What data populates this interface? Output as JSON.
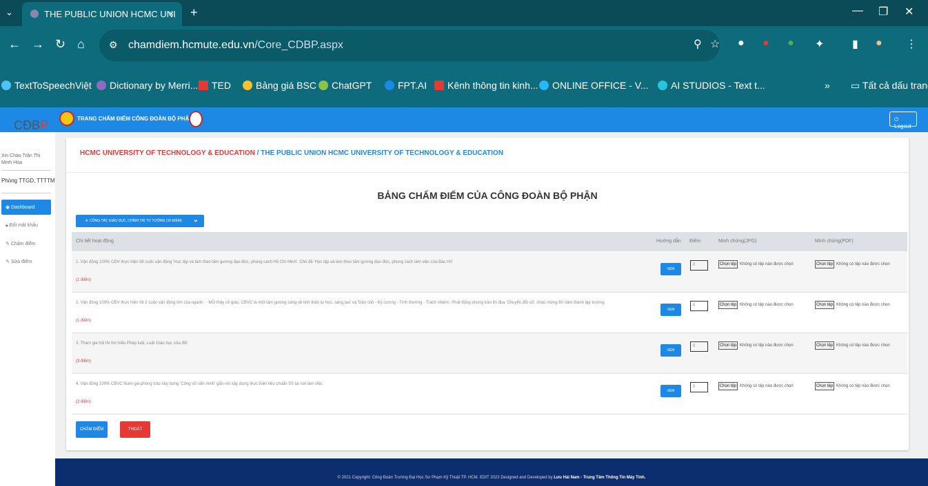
{
  "browser": {
    "tab_title": "THE PUBLIC UNION HCMC UNI",
    "tab_close": "×",
    "new_tab": "+",
    "menu_icon": "⌄",
    "url_host": "chamdiem.hcmute.edu.vn",
    "url_path": "/Core_CDBP.aspx",
    "bookmarks": [
      "TextToSpeechViệt",
      "Dictionary by Merri...",
      "TED",
      "Bảng giá BSC",
      "ChatGPT",
      "FPT.AI",
      "Kênh thông tin kinh...",
      "ONLINE OFFICE - V...",
      "AI STUDIOS - Text t..."
    ],
    "bookmarks_more": "»",
    "all_bookmarks": "Tất cả dấu trang"
  },
  "app": {
    "header_title": "TRANG CHẤM ĐIỂM CÔNG ĐOÀN BỘ PHẬN",
    "logout": "Logout",
    "brand_prefix": "CĐB",
    "brand_suffix": "P"
  },
  "sidebar": {
    "greeting": "Xin Chào Trần Thị Minh Hòa",
    "department": "Phòng TTGD, TTTTMT",
    "items": [
      "Dashboard",
      "Đổi mật khẩu",
      "Chấm điểm",
      "Sửa điểm"
    ]
  },
  "main": {
    "breadcrumb_1": "HCMC UNIVERSITY OF TECHNOLOGY & EDUCATION",
    "breadcrumb_sep": " / ",
    "breadcrumb_2": "THE PUBLIC UNION HCMC UNIVERSITY OF TECHNOLOGY & EDUCATION",
    "heading": "BẢNG CHẤM ĐIỂM CỦA CÔNG ĐOÀN BỘ PHẬN",
    "section_select": "A. CÔNG TÁC GIÁO DỤC, CHÍNH TRỊ TƯ TƯỞNG (10 ĐIỂM)",
    "columns": [
      "Chi tiết hoạt động",
      "Hướng dẫn",
      "Điểm",
      "Minh chứng(JPG)",
      "Minh chứng(PDF)"
    ],
    "view_label": "XEM",
    "choose_file": "Chọn tệp",
    "no_file": "Không có tệp nào được chọn",
    "rows": [
      {
        "text": "1. Vận động 100% CĐV thực hiện tốt cuộc vận động 'Học tập và làm theo tấm gương đạo đức, phong cách Hồ Chí Minh'. Chủ đề 'Học tập và làm theo tấm gương đạo đức, phong cách làm việc của Bác Hồ'",
        "points": "(1 điểm)",
        "score": "0"
      },
      {
        "text": "2. Vận động 100% CĐV thực hiện tốt 2 cuộc vận động lớn của ngành: - 'Mỗi thầy cô giáo, CBVC là một tấm gương sáng về tinh thần tự học, sáng tạo' và 'Dân chủ - Kỷ cương - Tình thương - Trách nhiệm'. Phát động phong trào thi đua 'Chuyển đổi số', chào mừng 60 năm thành lập trường",
        "points": "(1 điểm)",
        "score": "0"
      },
      {
        "text": "3. Tham gia hội thi tìm hiểu Pháp luật, Luật Giáo dục sửa đổi",
        "points": "(3 điểm)",
        "score": "0"
      },
      {
        "text": "4. Vận động 100% CBVC tham gia phong trào xây dựng 'Công sở văn minh' gắn với xây dựng thực hiện tiêu chuẩn 5S tại nơi làm việc",
        "points": "(2 điểm)",
        "score": "0"
      }
    ],
    "submit": "CHẤM ĐIỂM",
    "exit": "THOÁT"
  },
  "footer": {
    "text": "© 2021 Copyright: Công Đoàn Trường Đại Học Sư Phạm Kỹ Thuật TP. HCM. EDIT 2022 Designed and Developed by ",
    "author": "Lưu Hải Nam - Trung Tâm Thông Tin Máy Tính."
  }
}
